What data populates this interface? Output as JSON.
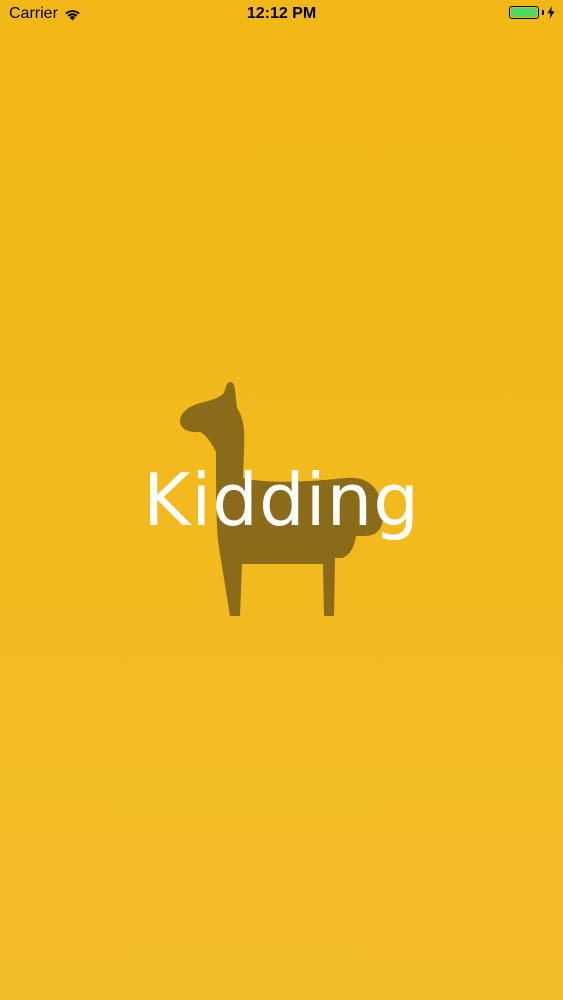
{
  "status_bar": {
    "carrier": "Carrier",
    "time": "12:12 PM",
    "battery_level": 1.0,
    "charging": true,
    "wifi_icon": "wifi-icon",
    "bolt_icon": "charging-bolt-icon"
  },
  "splash": {
    "title": "Kidding",
    "logo_icon": "llama-icon",
    "colors": {
      "background": "#F2B91C",
      "logo": "#8A6B1A",
      "title": "#FFFFFF",
      "battery_fill": "#4CD964"
    }
  }
}
